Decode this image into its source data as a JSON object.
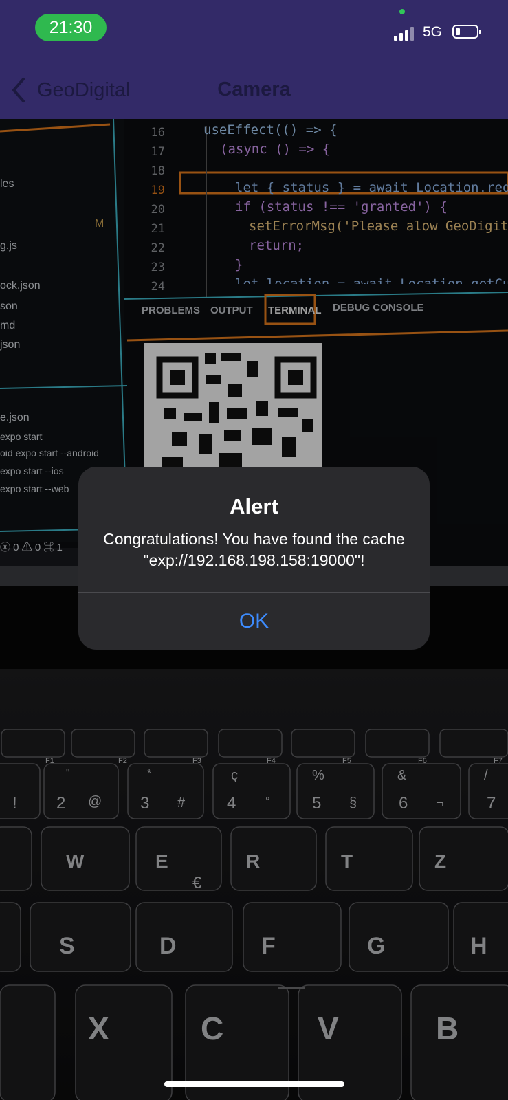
{
  "status_bar": {
    "time": "21:30",
    "network": "5G"
  },
  "nav": {
    "back_label": "GeoDigital",
    "title": "Camera"
  },
  "camera_view": {
    "line_numbers": [
      "16",
      "17",
      "18",
      "19",
      "20",
      "21",
      "22",
      "23",
      "24"
    ],
    "code_lines": [
      "useEffect(() => {",
      "(async () => {",
      "",
      "let { status } = await Location.reques",
      "if (status !== 'granted') {",
      "setErrorMsg('Please alow GeoDigital t",
      "return;",
      "}",
      "let location = await Location.getCurrent"
    ],
    "sidebar_items": [
      "les",
      "M",
      "g.js",
      "ock.json",
      "son",
      "md",
      "json",
      "e.json",
      "expo start",
      "oid  expo start --android",
      "expo start --ios",
      "expo start --web"
    ],
    "status_footer": "ⓧ 0 ⚠ 0   ⌘ 1",
    "panel_tabs": [
      "PROBLEMS",
      "OUTPUT",
      "TERMINAL",
      "DEBUG CONSOLE"
    ],
    "fn_keys": [
      "F1",
      "F2",
      "F3",
      "F4",
      "F5",
      "F6",
      "F7"
    ],
    "number_keys": [
      "!",
      "2",
      "@",
      "3",
      "#",
      "4",
      "°",
      "5",
      "§",
      "6",
      "¬",
      "7"
    ],
    "number_keys_top": [
      "\"",
      "*",
      "ç",
      "%",
      "&",
      "/"
    ],
    "letter_row_1": [
      "W",
      "E",
      "R",
      "T",
      "Z"
    ],
    "euro_glyph": "€",
    "letter_row_2": [
      "S",
      "D",
      "F",
      "G",
      "H"
    ],
    "letter_row_3": [
      "X",
      "C",
      "V",
      "B"
    ]
  },
  "alert": {
    "title": "Alert",
    "message": "Congratulations! You have found the cache \"exp://192.168.198.158:19000\"!",
    "ok_label": "OK"
  },
  "colors": {
    "header_bg": "#332a68",
    "time_pill": "#2fb94f",
    "alert_bg": "#2a2a2d",
    "alert_button": "#3d8bfd",
    "editor_orange": "#e07a1c",
    "editor_teal": "#3fb6c8"
  }
}
